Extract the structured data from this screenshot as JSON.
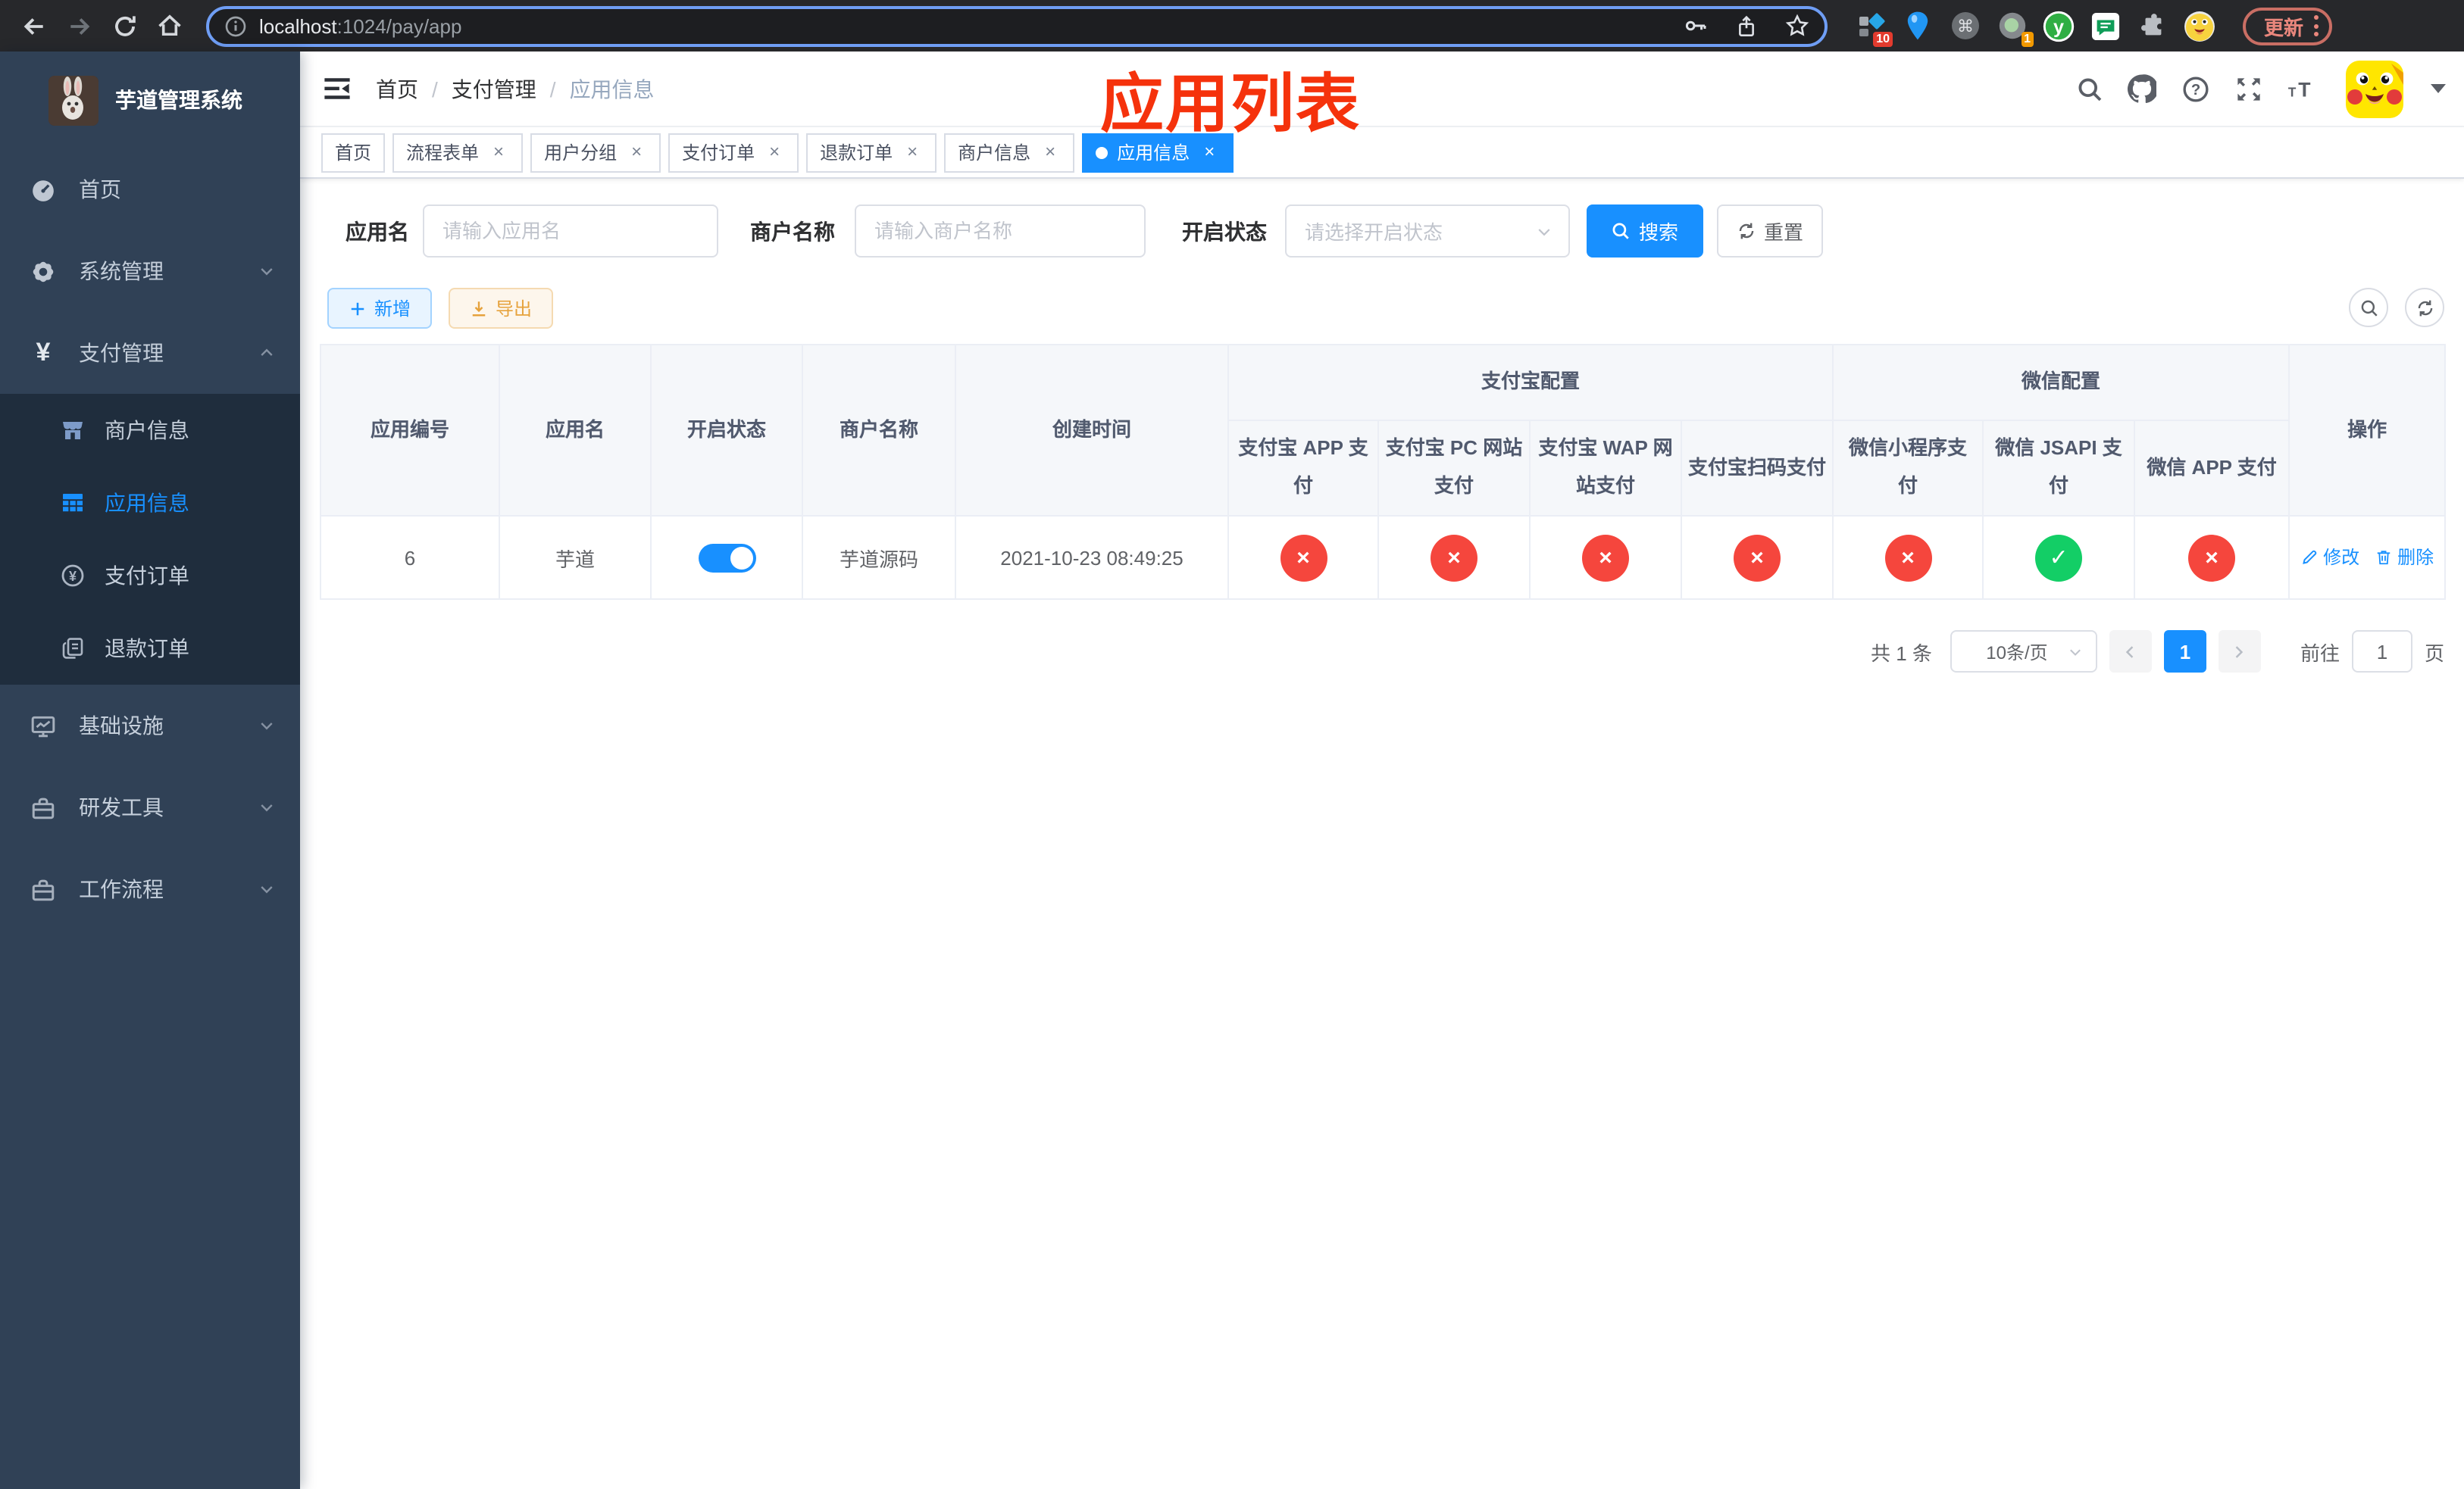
{
  "colors": {
    "accent": "#1890ff",
    "status_off": "#f5463d",
    "status_on": "#13ce66",
    "sidebar_bg": "#304156",
    "submenu_bg": "#1f2d3d",
    "annotation_red": "#f5320c",
    "warning": "#e6a23c"
  },
  "browser": {
    "url_host": "localhost",
    "url_path": ":1024/pay/app",
    "update_button": "更新",
    "ext_badge_blue_diamond": "10",
    "ext_badge_gray_circle": "1",
    "ext_y_label": "y"
  },
  "sidebar": {
    "title": "芋道管理系统",
    "items": [
      {
        "label": "首页"
      },
      {
        "label": "系统管理"
      },
      {
        "label": "支付管理"
      },
      {
        "label": "商户信息"
      },
      {
        "label": "应用信息"
      },
      {
        "label": "支付订单"
      },
      {
        "label": "退款订单"
      },
      {
        "label": "基础设施"
      },
      {
        "label": "研发工具"
      },
      {
        "label": "工作流程"
      }
    ]
  },
  "navbar": {
    "breadcrumb": [
      "首页",
      "支付管理",
      "应用信息"
    ],
    "annotation": "应用列表"
  },
  "tabs": [
    {
      "label": "首页"
    },
    {
      "label": "流程表单"
    },
    {
      "label": "用户分组"
    },
    {
      "label": "支付订单"
    },
    {
      "label": "退款订单"
    },
    {
      "label": "商户信息"
    },
    {
      "label": "应用信息"
    }
  ],
  "filters": {
    "app_name_label": "应用名",
    "app_name_placeholder": "请输入应用名",
    "merchant_label": "商户名称",
    "merchant_placeholder": "请输入商户名称",
    "status_label": "开启状态",
    "status_placeholder": "请选择开启状态",
    "search_label": "搜索",
    "reset_label": "重置"
  },
  "actions": {
    "add": "新增",
    "export": "导出"
  },
  "table": {
    "headers": {
      "app_id": "应用编号",
      "app_name": "应用名",
      "enabled": "开启状态",
      "merchant": "商户名称",
      "created": "创建时间",
      "alipay_group": "支付宝配置",
      "wechat_group": "微信配置",
      "alipay_app": "支付宝 APP 支付",
      "alipay_pc": "支付宝 PC 网站支付",
      "alipay_wap": "支付宝 WAP 网站支付",
      "alipay_qr": "支付宝扫码支付",
      "wx_mini": "微信小程序支付",
      "wx_jsapi": "微信 JSAPI 支付",
      "wx_app": "微信 APP 支付",
      "ops": "操作"
    },
    "row": {
      "app_id": "6",
      "app_name": "芋道",
      "enabled": true,
      "merchant": "芋道源码",
      "created": "2021-10-23 08:49:25",
      "configs": [
        false,
        false,
        false,
        false,
        false,
        true,
        false
      ],
      "edit": "修改",
      "delete": "删除"
    }
  },
  "pagination": {
    "total": "共 1 条",
    "page_size": "10条/页",
    "current_page": "1",
    "goto_label": "前往",
    "page_unit": "页"
  }
}
